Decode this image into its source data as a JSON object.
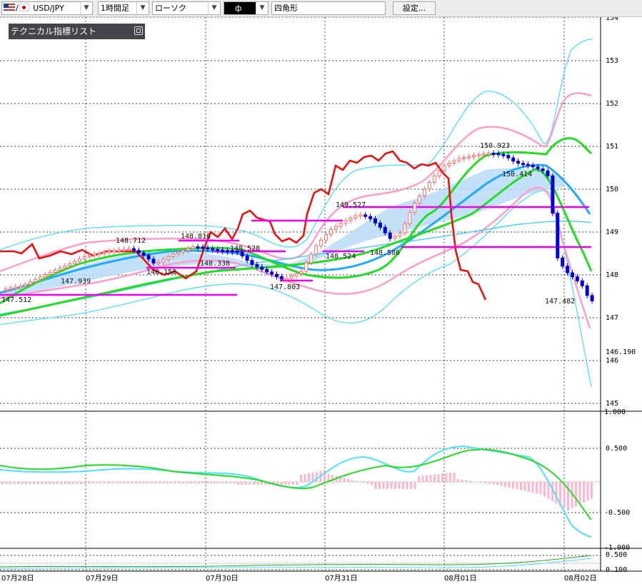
{
  "toolbar": {
    "symbol": "USD/JPY",
    "timeframe": "1時間足",
    "chart_type": "ローソク",
    "drawing_tool": "ф",
    "shape": "四角形",
    "settings_label": "設定..."
  },
  "panel": {
    "title": "テクニカル指標リスト"
  },
  "price_axis": {
    "labels": [
      "154",
      "153",
      "152",
      "151",
      "150",
      "149",
      "148",
      "147",
      "146",
      "145"
    ],
    "last_price_label": "146.190"
  },
  "macd_axis": {
    "labels": [
      "1.000",
      "0.500",
      "-0.500",
      "-1.000"
    ]
  },
  "sub_axis": {
    "labels": [
      "0.500",
      "0.100"
    ]
  },
  "date_labels": [
    "07月28日",
    "07月29日",
    "07月30日",
    "07月31日",
    "08月01日",
    "08月02日"
  ],
  "annotations": [
    "147.512",
    "147.939",
    "148.712",
    "148.158",
    "148.810",
    "148.528",
    "148.338",
    "147.803",
    "149.527",
    "148.524",
    "148.586",
    "150.923",
    "150.414",
    "147.482"
  ],
  "colors": {
    "candle_up": "#ff6b6b",
    "candle_down": "#0000dd",
    "bollinger_outer": "#4fe0ff",
    "bollinger_inner": "#ff9fc8",
    "ma_fast": "#22dd22",
    "ma_slow": "#22aaff",
    "rci": "#ee1111",
    "support_lines": "#ee00ee",
    "cloud": "#b9dcf7"
  }
}
